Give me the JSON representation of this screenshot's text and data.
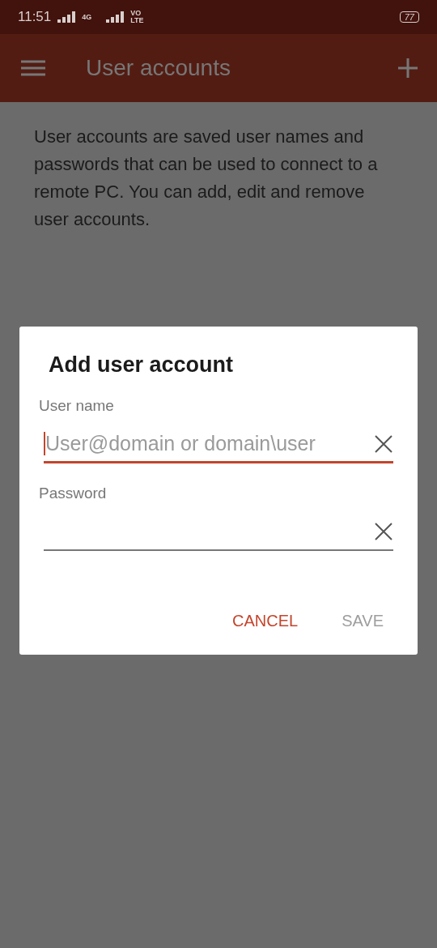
{
  "status_bar": {
    "time": "11:51",
    "network": "4G",
    "volte": "VO LTE",
    "battery": "77"
  },
  "app_bar": {
    "title": "User accounts"
  },
  "description": "User accounts are saved user names and passwords that can be used to connect to a remote PC. You can add, edit and remove user accounts.",
  "dialog": {
    "title": "Add user account",
    "fields": [
      {
        "label": "User name",
        "placeholder": "User@domain or domain\\user",
        "focused": true
      },
      {
        "label": "Password",
        "focused": false
      }
    ],
    "buttons": [
      {
        "label": "CANCEL",
        "disabled": false
      },
      {
        "label": "SAVE",
        "disabled": true
      }
    ]
  }
}
